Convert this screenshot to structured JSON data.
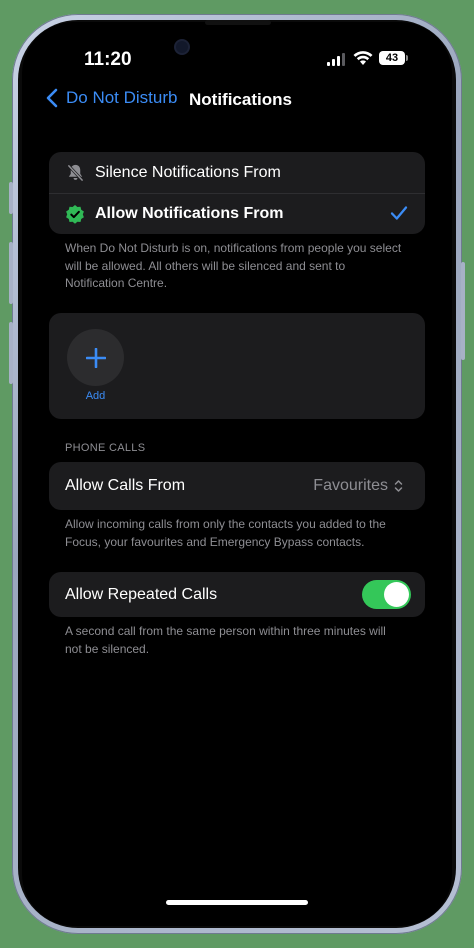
{
  "status": {
    "time": "11:20",
    "battery": "43"
  },
  "nav": {
    "back_label": "Do Not Disturb",
    "title": "Notifications"
  },
  "mode_options": [
    {
      "label": "Silence Notifications From",
      "selected": false
    },
    {
      "label": "Allow Notifications From",
      "selected": true
    }
  ],
  "mode_footnote": "When Do Not Disturb is on, notifications from people you select will be allowed. All others will be silenced and sent to Notification Centre.",
  "people": {
    "add_label": "Add"
  },
  "phone_calls": {
    "header": "PHONE CALLS",
    "allow_calls_label": "Allow Calls From",
    "allow_calls_value": "Favourites",
    "allow_calls_footnote": "Allow incoming calls from only the contacts you added to the Focus, your favourites and Emergency Bypass contacts."
  },
  "repeated_calls": {
    "label": "Allow Repeated Calls",
    "enabled": true,
    "footnote": "A second call from the same person within three minutes will not be silenced."
  },
  "colors": {
    "accent": "#3b8cf5",
    "toggle_on": "#34c759",
    "verified_green": "#30b956",
    "background": "#000000",
    "cell": "#1c1c1e"
  }
}
